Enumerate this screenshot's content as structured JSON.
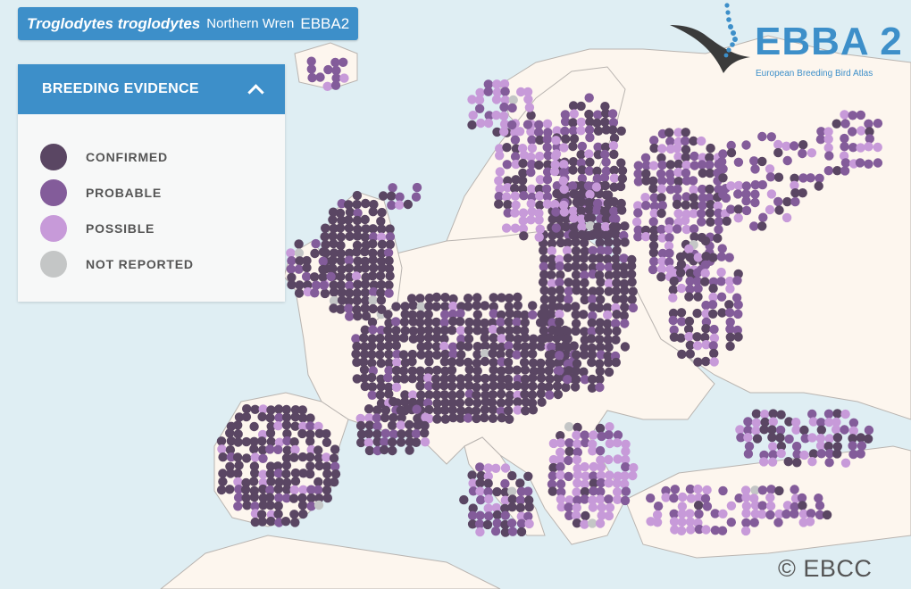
{
  "title": {
    "scientific_name": "Troglodytes troglodytes",
    "common_name": "Northern Wren",
    "atlas": "EBBA2"
  },
  "legend": {
    "heading": "BREEDING EVIDENCE",
    "toggle_icon": "chevron-up-icon",
    "items": [
      {
        "label": "CONFIRMED",
        "color": "#5a4663"
      },
      {
        "label": "PROBABLE",
        "color": "#835c9a"
      },
      {
        "label": "POSSIBLE",
        "color": "#c79ad9"
      },
      {
        "label": "NOT REPORTED",
        "color": "#c4c6c6"
      }
    ]
  },
  "logo": {
    "text": "EBBA 2",
    "subtitle": "European Breeding Bird Atlas",
    "icon": "bird-logo-icon"
  },
  "copyright": "© EBCC",
  "colors": {
    "sea": "#dfeef3",
    "land": "#fdf6ee",
    "border": "#b9b4b0",
    "accent": "#3d8fc9"
  }
}
